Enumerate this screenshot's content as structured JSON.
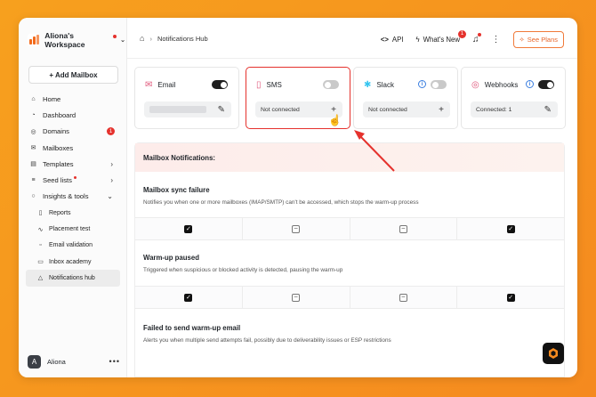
{
  "workspace": {
    "name": "Aliona's Workspace"
  },
  "sidebar": {
    "add_mailbox": "+ Add Mailbox",
    "items": [
      {
        "label": "Home"
      },
      {
        "label": "Dashboard"
      },
      {
        "label": "Domains",
        "badge": "1"
      },
      {
        "label": "Mailboxes"
      },
      {
        "label": "Templates"
      },
      {
        "label": "Seed lists"
      },
      {
        "label": "Insights & tools"
      },
      {
        "label": "Reports"
      },
      {
        "label": "Placement test"
      },
      {
        "label": "Email validation"
      },
      {
        "label": "Inbox academy"
      },
      {
        "label": "Notifications hub"
      }
    ],
    "user": {
      "initial": "A",
      "name": "Aliona",
      "more": "•••"
    }
  },
  "header": {
    "breadcrumb": "Notifications Hub",
    "api_label": "API",
    "whats_new_label": "What's New",
    "whats_new_badge": "1",
    "plans_label": "See Plans"
  },
  "channels": [
    {
      "name": "Email",
      "toggle": true,
      "field": "",
      "action": "✎"
    },
    {
      "name": "SMS",
      "toggle": false,
      "field": "Not connected",
      "action": "+"
    },
    {
      "name": "Slack",
      "toggle": false,
      "info": "i",
      "field": "Not connected",
      "action": "+"
    },
    {
      "name": "Webhooks",
      "toggle": true,
      "info": "i",
      "field": "Connected: 1",
      "action": "✎"
    }
  ],
  "notifications": {
    "heading": "Mailbox Notifications:",
    "sections": [
      {
        "title": "Mailbox sync failure",
        "desc": "Notifies you when one or more mailboxes (IMAP/SMTP) can't be accessed, which stops the warm-up process",
        "states": [
          "checked",
          "partial",
          "partial",
          "checked"
        ]
      },
      {
        "title": "Warm-up paused",
        "desc": "Triggered when suspicious or blocked activity is detected, pausing the warm-up",
        "states": [
          "checked",
          "partial",
          "partial",
          "checked"
        ]
      },
      {
        "title": "Failed to send warm-up email",
        "desc": "Alerts you when multiple send attempts fail, possibly due to deliverability issues or ESP restrictions"
      }
    ]
  },
  "colors": {
    "accent": "#e5322d",
    "brand_orange": "#f58a1f",
    "toggle_on": "#1f1f1f"
  }
}
